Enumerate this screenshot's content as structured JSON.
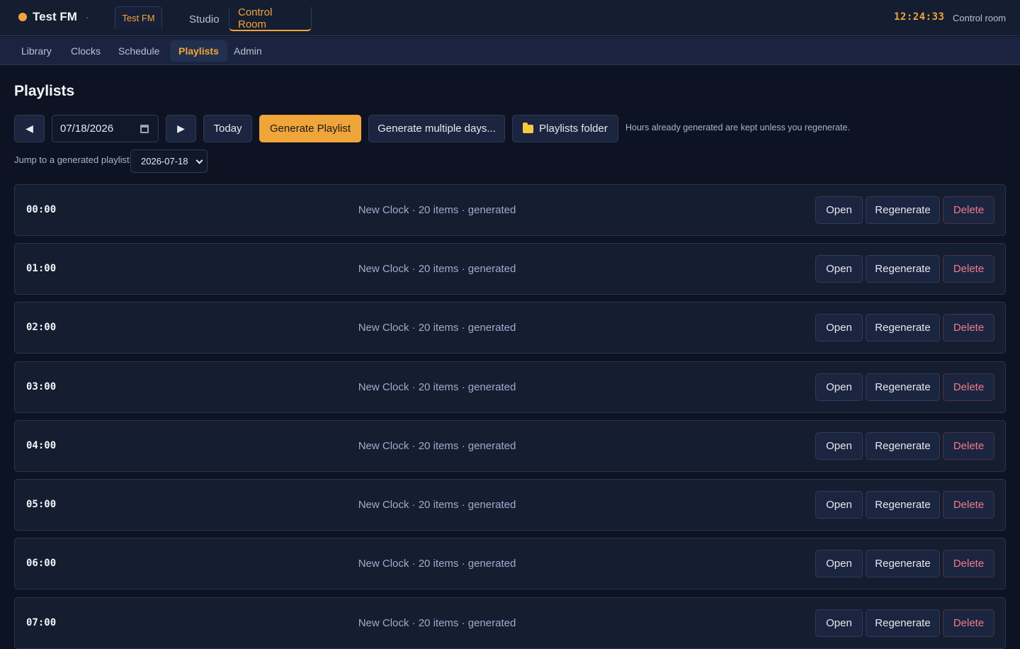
{
  "header": {
    "station_name": "Test FM",
    "station_sep": "·",
    "station_chip": "Test FM",
    "mode_tabs": [
      "Studio",
      "Control Room"
    ],
    "active_mode": "Control Room",
    "clock": "12:24:33",
    "clock_label": "Control room",
    "accent": "#f0a53a"
  },
  "subnav": {
    "items": [
      "Library",
      "Clocks",
      "Schedule",
      "Playlists",
      "Admin"
    ],
    "active": "Playlists"
  },
  "main": {
    "title": "Playlists",
    "toolbar": {
      "prev_icon": "◀",
      "next_icon": "▶",
      "date_value": "07/18/2026",
      "today_label": "Today",
      "generate_label": "Generate Playlist",
      "generate_multi_label": "Generate multiple days...",
      "folder_label": "Playlists folder",
      "hint": "Hours already generated are kept unless you regenerate."
    },
    "jump": {
      "label": "Jump to a generated playlist:",
      "selected": "2026-07-18"
    },
    "rows": [
      {
        "hour": "00:00",
        "meta": "New Clock · 20 items · generated"
      },
      {
        "hour": "01:00",
        "meta": "New Clock · 20 items · generated"
      },
      {
        "hour": "02:00",
        "meta": "New Clock · 20 items · generated"
      },
      {
        "hour": "03:00",
        "meta": "New Clock · 20 items · generated"
      },
      {
        "hour": "04:00",
        "meta": "New Clock · 20 items · generated"
      },
      {
        "hour": "05:00",
        "meta": "New Clock · 20 items · generated"
      },
      {
        "hour": "06:00",
        "meta": "New Clock · 20 items · generated"
      },
      {
        "hour": "07:00",
        "meta": "New Clock · 20 items · generated"
      }
    ],
    "row_actions": {
      "open": "Open",
      "regenerate": "Regenerate",
      "delete": "Delete"
    }
  }
}
